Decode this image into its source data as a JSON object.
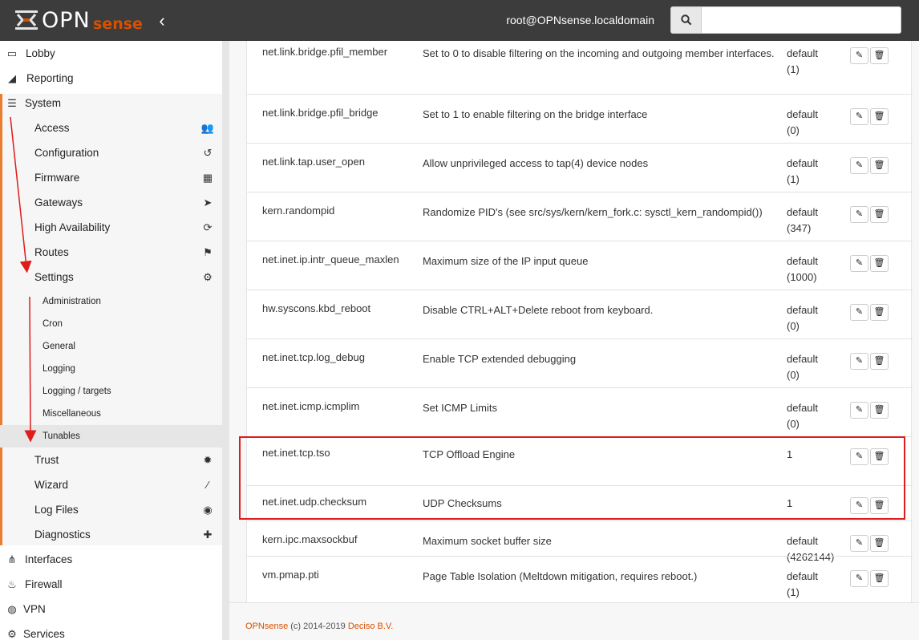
{
  "header": {
    "logo_primary": "OPN",
    "logo_secondary": "sense",
    "user": "root@OPNsense.localdomain",
    "search_placeholder": ""
  },
  "sidebar": {
    "top_items": [
      {
        "label": "Lobby",
        "icon": "laptop-icon"
      },
      {
        "label": "Reporting",
        "icon": "area-chart-icon"
      },
      {
        "label": "System",
        "icon": "server-icon"
      }
    ],
    "system_items": [
      {
        "label": "Access",
        "icon": "users-icon"
      },
      {
        "label": "Configuration",
        "icon": "history-icon"
      },
      {
        "label": "Firmware",
        "icon": "building-icon"
      },
      {
        "label": "Gateways",
        "icon": "location-arrow-icon"
      },
      {
        "label": "High Availability",
        "icon": "refresh-icon"
      },
      {
        "label": "Routes",
        "icon": "map-signs-icon"
      },
      {
        "label": "Settings",
        "icon": "cogs-icon"
      }
    ],
    "settings_items": [
      "Administration",
      "Cron",
      "General",
      "Logging",
      "Logging / targets",
      "Miscellaneous",
      "Tunables"
    ],
    "system_items_after": [
      {
        "label": "Trust",
        "icon": "certificate-icon"
      },
      {
        "label": "Wizard",
        "icon": "magic-icon"
      },
      {
        "label": "Log Files",
        "icon": "eye-icon"
      },
      {
        "label": "Diagnostics",
        "icon": "medkit-icon"
      }
    ],
    "bottom_items": [
      {
        "label": "Interfaces",
        "icon": "sitemap-icon"
      },
      {
        "label": "Firewall",
        "icon": "fire-icon"
      },
      {
        "label": "VPN",
        "icon": "globe-icon"
      },
      {
        "label": "Services",
        "icon": "cog-icon"
      }
    ]
  },
  "tunables": {
    "rows": [
      {
        "name": "net.link.bridge.pfil_member",
        "desc": "Set to 0 to disable filtering on the incoming and outgoing member interfaces.",
        "val1": "default",
        "val2": "(1)"
      },
      {
        "name": "net.link.bridge.pfil_bridge",
        "desc": "Set to 1 to enable filtering on the bridge interface",
        "val1": "default",
        "val2": "(0)"
      },
      {
        "name": "net.link.tap.user_open",
        "desc": "Allow unprivileged access to tap(4) device nodes",
        "val1": "default",
        "val2": "(1)"
      },
      {
        "name": "kern.randompid",
        "desc": "Randomize PID's (see src/sys/kern/kern_fork.c: sysctl_kern_randompid())",
        "val1": "default",
        "val2": "(347)"
      },
      {
        "name": "net.inet.ip.intr_queue_maxlen",
        "desc": "Maximum size of the IP input queue",
        "val1": "default",
        "val2": "(1000)"
      },
      {
        "name": "hw.syscons.kbd_reboot",
        "desc": "Disable CTRL+ALT+Delete reboot from keyboard.",
        "val1": "default",
        "val2": "(0)"
      },
      {
        "name": "net.inet.tcp.log_debug",
        "desc": "Enable TCP extended debugging",
        "val1": "default",
        "val2": "(0)"
      },
      {
        "name": "net.inet.icmp.icmplim",
        "desc": "Set ICMP Limits",
        "val1": "default",
        "val2": "(0)"
      },
      {
        "name": "net.inet.tcp.tso",
        "desc": "TCP Offload Engine",
        "val1": "1",
        "val2": ""
      },
      {
        "name": "net.inet.udp.checksum",
        "desc": "UDP Checksums",
        "val1": "1",
        "val2": ""
      },
      {
        "name": "kern.ipc.maxsockbuf",
        "desc": "Maximum socket buffer size",
        "val1": "default",
        "val2": "(4262144)"
      },
      {
        "name": "vm.pmap.pti",
        "desc": "Page Table Isolation (Meltdown mitigation, requires reboot.)",
        "val1": "default",
        "val2": "(1)"
      }
    ]
  },
  "footer": {
    "brand": "OPNsense",
    "copyright": " (c) 2014-2019 ",
    "company": "Deciso B.V."
  },
  "colors": {
    "accent": "#d94f00",
    "highlight": "#e01b1b",
    "header_bg": "#3c3c3c"
  }
}
